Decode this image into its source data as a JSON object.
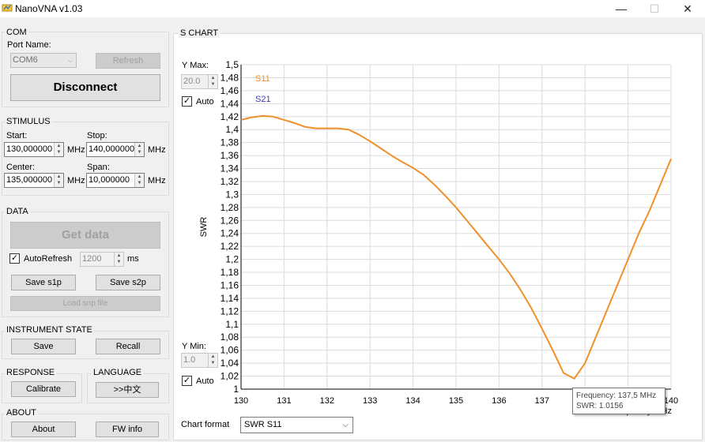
{
  "window": {
    "title": "NanoVNA v1.03",
    "minimize_glyph": "—",
    "maximize_glyph": "☐",
    "close_glyph": "✕"
  },
  "com": {
    "title": "COM",
    "port_label": "Port Name:",
    "port_value": "COM6",
    "refresh_label": "Refresh",
    "disconnect_label": "Disconnect"
  },
  "stimulus": {
    "title": "STIMULUS",
    "start_label": "Start:",
    "start_value": "130,000000",
    "stop_label": "Stop:",
    "stop_value": "140,000000",
    "center_label": "Center:",
    "center_value": "135,000000",
    "span_label": "Span:",
    "span_value": "10,000000",
    "unit": "MHz"
  },
  "data_group": {
    "title": "DATA",
    "get_data_label": "Get data",
    "autorefresh_label": "AutoRefresh",
    "autorefresh_checked": true,
    "interval_value": "1200",
    "interval_unit": "ms",
    "save_s1p_label": "Save s1p",
    "save_s2p_label": "Save s2p",
    "load_snp_label": "Load snp file"
  },
  "instrument_state": {
    "title": "INSTRUMENT STATE",
    "save_label": "Save",
    "recall_label": "Recall"
  },
  "response": {
    "title": "RESPONSE",
    "calibrate_label": "Calibrate"
  },
  "language": {
    "title": "LANGUAGE",
    "button_label": ">>中文"
  },
  "about": {
    "title": "ABOUT",
    "about_label": "About",
    "fw_info_label": "FW info"
  },
  "chart_panel": {
    "title": "S CHART",
    "ymax_label": "Y Max:",
    "ymax_value": "20.0",
    "ymin_label": "Y Min:",
    "ymin_value": "1.0",
    "auto_label": "Auto",
    "format_label": "Chart format",
    "format_value": "SWR S11",
    "tooltip_freq_label": "Frequency",
    "tooltip_freq_value": ": 137,5 MHz",
    "tooltip_swr_label": "SWR",
    "tooltip_swr_value": ": 1.0156"
  },
  "colors": {
    "s11": "#f0902a",
    "s21": "#3b3bbf",
    "grid": "#dcdcdc"
  },
  "chart_data": {
    "type": "line",
    "ylabel": "SWR",
    "xlabel": "Frequency MHz",
    "ylim": [
      1,
      1.5
    ],
    "xlim": [
      130,
      140
    ],
    "yticks": [
      "1,5",
      "1,48",
      "1,46",
      "1,44",
      "1,42",
      "1,4",
      "1,38",
      "1,36",
      "1,34",
      "1,32",
      "1,3",
      "1,28",
      "1,26",
      "1,24",
      "1,22",
      "1,2",
      "1,18",
      "1,16",
      "1,14",
      "1,12",
      "1,1",
      "1,08",
      "1,06",
      "1,04",
      "1,02",
      "1"
    ],
    "xticks": [
      "130",
      "131",
      "132",
      "133",
      "134",
      "135",
      "136",
      "137",
      "138",
      "139",
      "140"
    ],
    "legend": [
      "S11",
      "S21"
    ],
    "grid": true,
    "series": [
      {
        "name": "S11",
        "x": [
          130,
          130.25,
          130.5,
          130.75,
          131,
          131.25,
          131.5,
          131.75,
          132,
          132.25,
          132.5,
          132.75,
          133,
          133.25,
          133.5,
          133.75,
          134,
          134.25,
          134.5,
          134.75,
          135,
          135.25,
          135.5,
          135.75,
          136,
          136.25,
          136.5,
          136.75,
          137,
          137.25,
          137.5,
          137.75,
          138,
          138.25,
          138.5,
          138.75,
          139,
          139.25,
          139.5,
          139.75,
          140
        ],
        "values": [
          1.415,
          1.419,
          1.421,
          1.42,
          1.415,
          1.41,
          1.404,
          1.402,
          1.402,
          1.402,
          1.4,
          1.392,
          1.382,
          1.371,
          1.36,
          1.35,
          1.341,
          1.33,
          1.315,
          1.298,
          1.28,
          1.26,
          1.24,
          1.22,
          1.2,
          1.178,
          1.153,
          1.125,
          1.093,
          1.06,
          1.025,
          1.016,
          1.04,
          1.08,
          1.12,
          1.16,
          1.2,
          1.24,
          1.275,
          1.315,
          1.355
        ]
      },
      {
        "name": "S21",
        "x": [],
        "values": []
      }
    ]
  }
}
